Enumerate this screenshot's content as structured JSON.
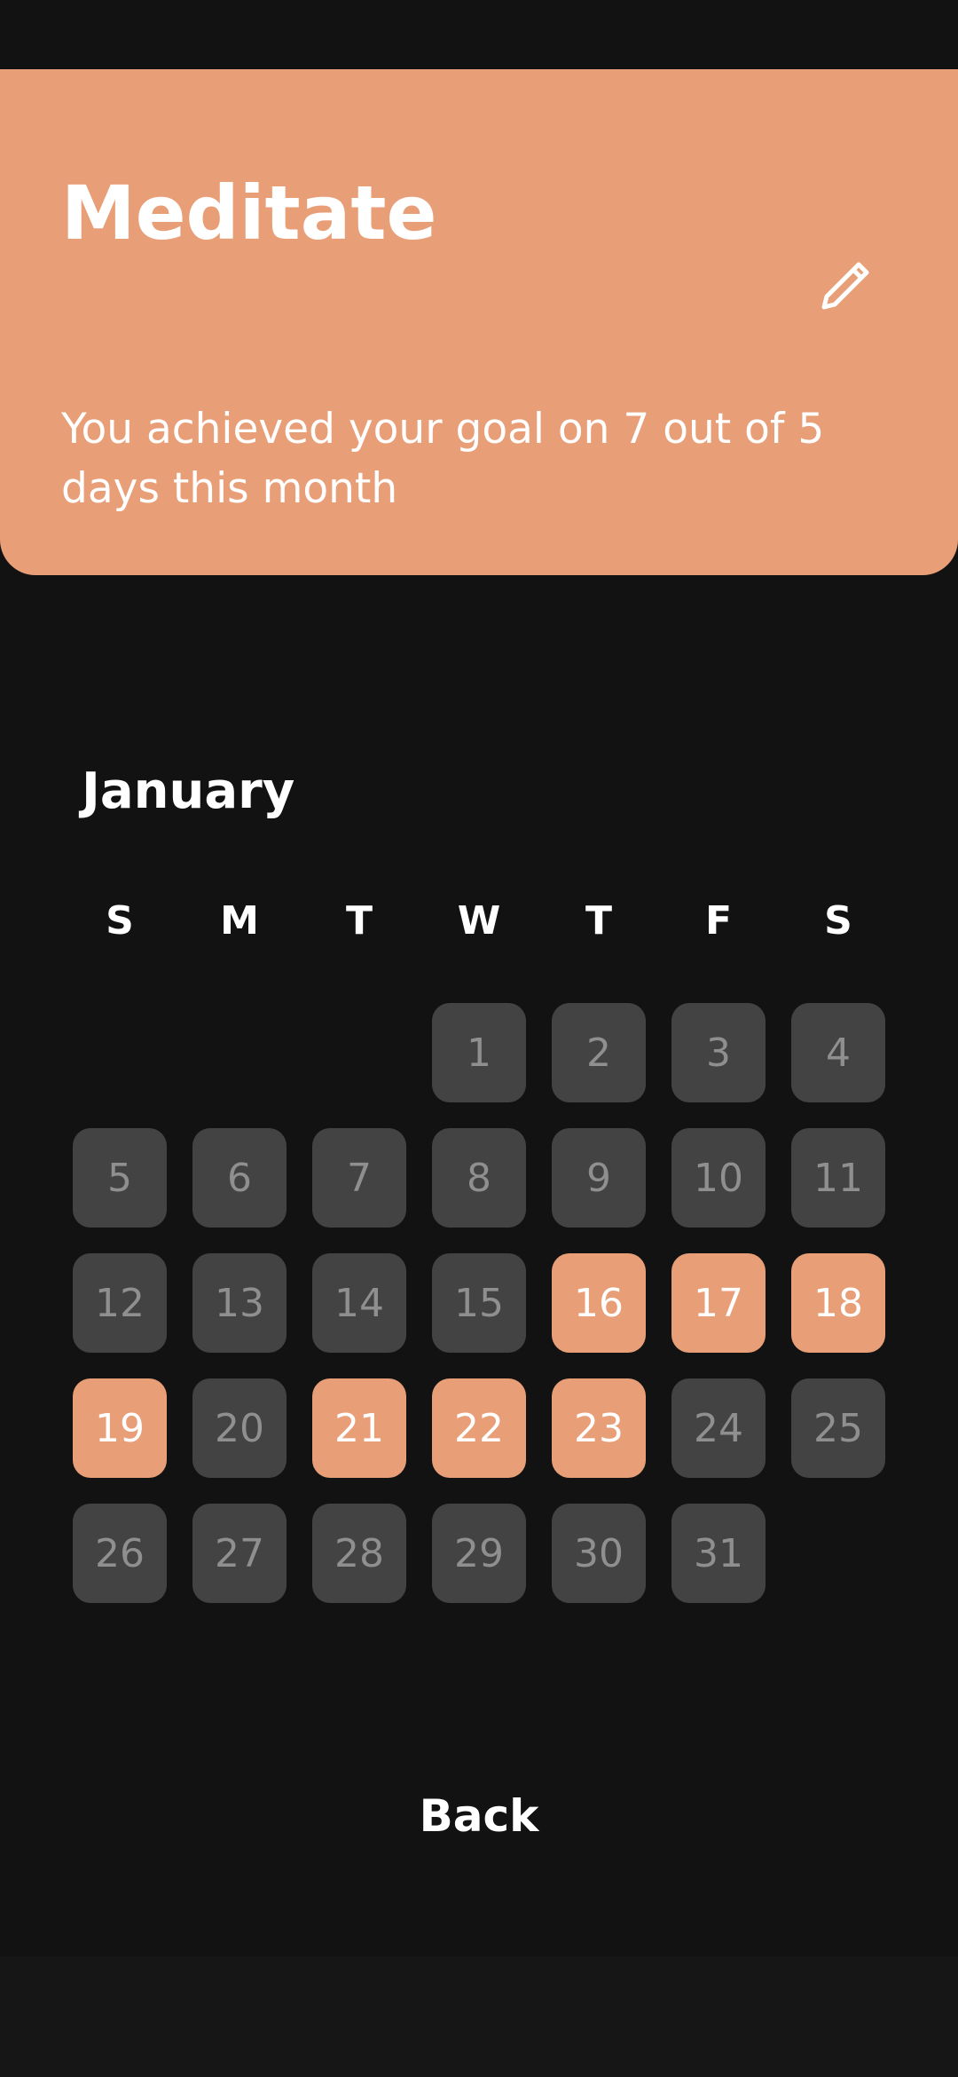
{
  "header": {
    "title": "Meditate",
    "summary": "You achieved your goal on 7 out of 5 days this month",
    "edit_icon": "pencil-icon",
    "accent_color": "#E89E77"
  },
  "calendar": {
    "month": "January",
    "weekdays": [
      "S",
      "M",
      "T",
      "W",
      "T",
      "F",
      "S"
    ],
    "first_weekday_index": 3,
    "days_in_month": 31,
    "completed_days": [
      16,
      17,
      18,
      19,
      21,
      22,
      23
    ],
    "colors": {
      "completed": "#E89E77",
      "default": "#434343",
      "default_text": "#8f8f8f"
    }
  },
  "footer": {
    "back_label": "Back"
  }
}
